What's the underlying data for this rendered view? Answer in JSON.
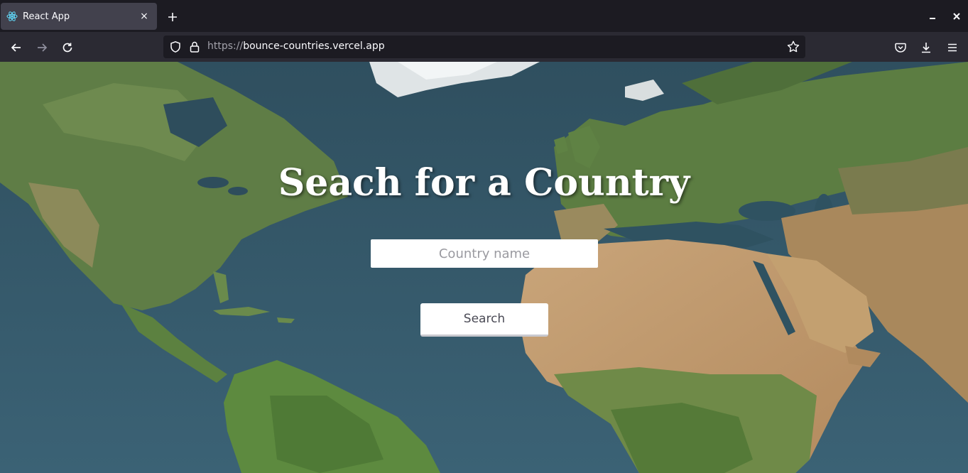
{
  "browser": {
    "tab": {
      "title": "React App",
      "favicon": "react-atom-icon",
      "close_label": "×"
    },
    "new_tab_label": "+",
    "url": {
      "scheme": "https://",
      "host": "bounce-countries.vercel.app"
    },
    "icons": {
      "back": "arrow-left-icon",
      "forward": "arrow-right-icon",
      "reload": "reload-icon",
      "shield": "shield-icon",
      "lock": "lock-icon",
      "bookmark": "star-icon",
      "pocket": "pocket-icon",
      "downloads": "download-icon",
      "menu": "hamburger-menu-icon",
      "minimize": "minimize-icon",
      "close": "close-icon"
    }
  },
  "page": {
    "heading": "Seach for a Country",
    "search": {
      "placeholder": "Country name",
      "value": ""
    },
    "button_label": "Search",
    "background": "satellite world map"
  },
  "colors": {
    "tabstrip": "#1c1b22",
    "tab_active": "#42414d",
    "navbar": "#2b2a33",
    "urlbar": "#1c1b22",
    "ocean": "#34566a",
    "heading_text": "#ffffff"
  }
}
